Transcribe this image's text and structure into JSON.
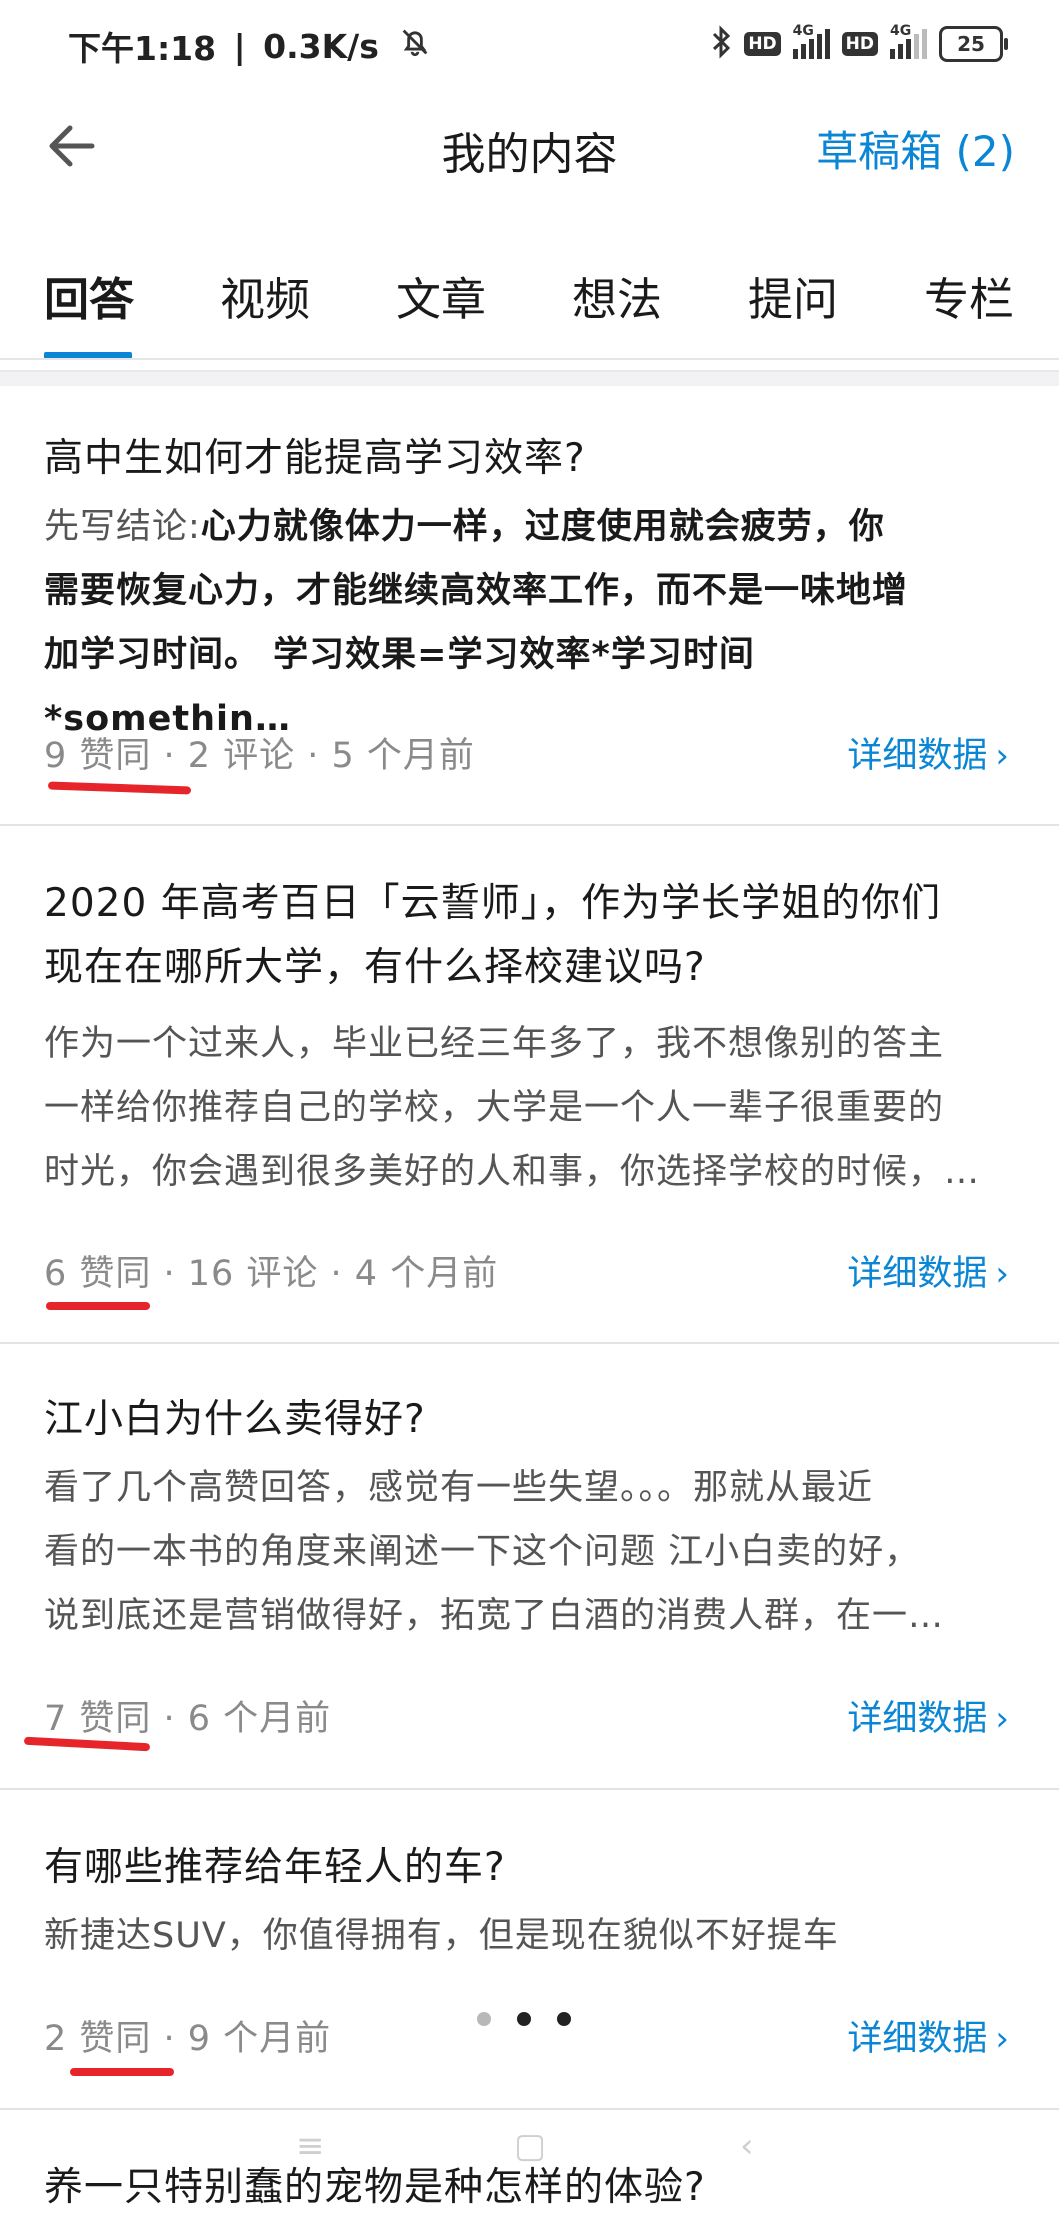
{
  "status_bar": {
    "time": "下午1:18",
    "speed": "0.3K/s",
    "hd_label": "HD",
    "net_label": "4G",
    "battery": "25"
  },
  "header": {
    "back_icon": "arrow-left-icon",
    "title": "我的内容",
    "drafts": "草稿箱 (2)"
  },
  "tabs": [
    "回答",
    "视频",
    "文章",
    "想法",
    "提问",
    "专栏"
  ],
  "active_tab": 0,
  "accent_color": "#0a86d4",
  "annotation_color": "#e6252b",
  "items": [
    {
      "question": "高中生如何才能提高学习效率?",
      "excerpt_prefix": "先写结论:",
      "excerpt_bold_1": "心力就像体力一样，过度使用就会疲劳，你",
      "excerpt_bold_2": "需要恢复心力，才能继续高效率工作，而不是一味地增",
      "excerpt_bold_3": "加学习时间。 学习效果=学习效率*学习时间*somethin…",
      "meta": "9 赞同 · 2 评论 · 5 个月前",
      "detail": "详细数据"
    },
    {
      "question_1": "2020 年高考百日「云誓师」，作为学长学姐的你们",
      "question_2": "现在在哪所大学，有什么择校建议吗?",
      "excerpt_1": "作为一个过来人，毕业已经三年多了，我不想像别的答主",
      "excerpt_2": "一样给你推荐自己的学校，大学是一个人一辈子很重要的",
      "excerpt_3": "时光，你会遇到很多美好的人和事，你选择学校的时候，…",
      "meta": "6 赞同 · 16 评论 · 4 个月前",
      "detail": "详细数据"
    },
    {
      "question": "江小白为什么卖得好?",
      "excerpt_1": "看了几个高赞回答，感觉有一些失望。。。那就从最近",
      "excerpt_2": "看的一本书的角度来阐述一下这个问题 江小白卖的好，",
      "excerpt_3": "说到底还是营销做得好，拓宽了白酒的消费人群，在一…",
      "meta": "7 赞同 · 6 个月前",
      "detail": "详细数据"
    },
    {
      "question": "有哪些推荐给年轻人的车?",
      "excerpt_1": "新捷达SUV，你值得拥有，但是现在貌似不好提车",
      "meta": "2 赞同 · 9 个月前",
      "detail": "详细数据"
    },
    {
      "question": "养一只特别蠢的宠物是种怎样的体验?"
    }
  ]
}
